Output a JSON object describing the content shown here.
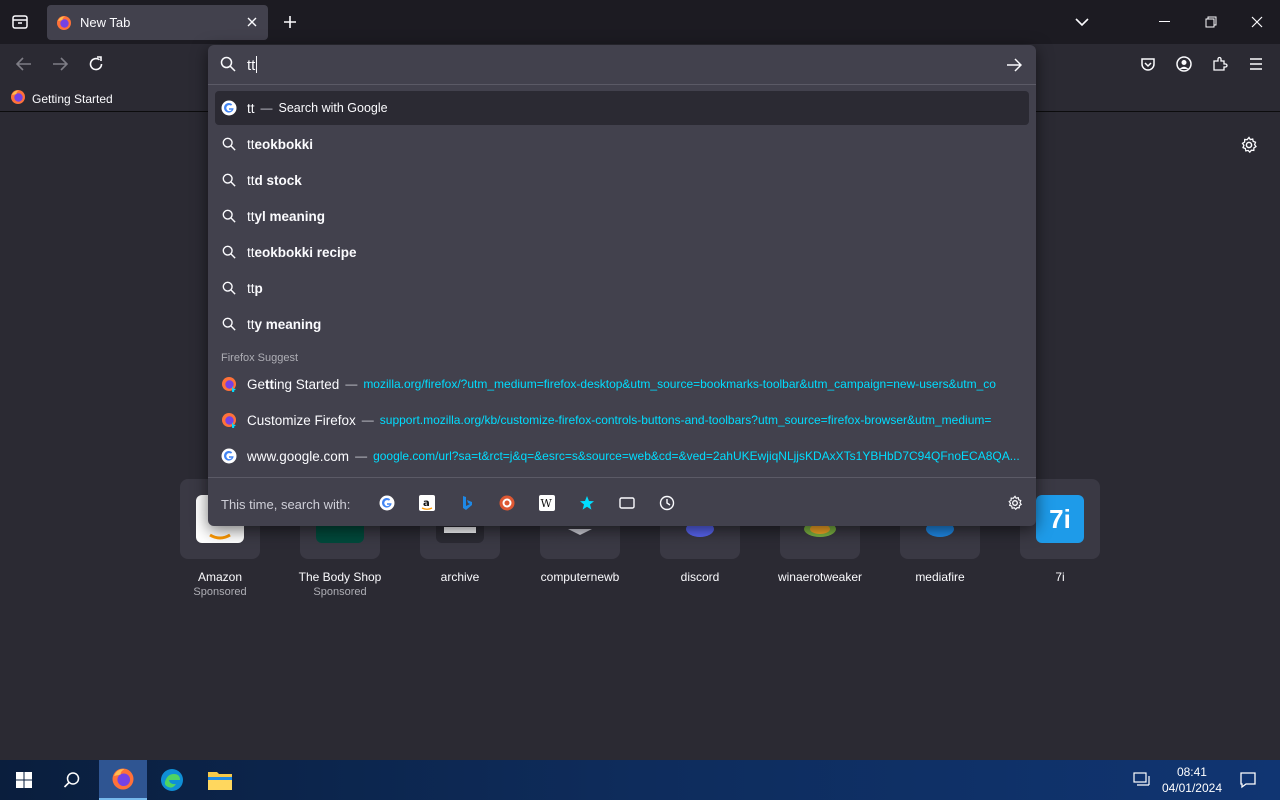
{
  "browser": {
    "tab_title": "New Tab",
    "bookmark_label": "Getting Started"
  },
  "urlbar": {
    "typed": "tt"
  },
  "results": {
    "heuristic": {
      "typed": "tt",
      "sep": "—",
      "action": "Search with Google"
    },
    "suggestions": [
      {
        "typed": "tt",
        "completion": "eokbokki"
      },
      {
        "typed": "tt",
        "completion": "d stock"
      },
      {
        "typed": "tt",
        "completion": "yl meaning"
      },
      {
        "typed": "tt",
        "completion": "eokbokki recipe"
      },
      {
        "typed": "tt",
        "completion": "p"
      },
      {
        "typed": "tt",
        "completion": "y meaning"
      }
    ],
    "group_label": "Firefox Suggest",
    "bookmarks": [
      {
        "title_pre": "Ge",
        "title_hl": "tt",
        "title_post": "ing Started",
        "sep": "—",
        "url": "mozilla.org/firefox/?utm_medium=firefox-desktop&utm_source=bookmarks-toolbar&utm_campaign=new-users&utm_co"
      },
      {
        "title_pre": "Customize Firefox",
        "title_hl": "",
        "title_post": "",
        "sep": "—",
        "url": "support.mozilla.org/kb/customize-firefox-controls-buttons-and-toolbars?utm_source=firefox-browser&utm_medium="
      },
      {
        "title_pre": "www.google.com",
        "title_hl": "",
        "title_post": "",
        "sep": "—",
        "url": "google.com/url?sa=t&rct=j&q=&esrc=s&source=web&cd=&ved=2ahUKEwjiqNLjjsKDAxXTs1YBHbD7C94QFnoECA8QA..."
      }
    ]
  },
  "oneoff": {
    "label": "This time, search with:"
  },
  "tiles": [
    {
      "label": "Amazon",
      "sub": "Sponsored"
    },
    {
      "label": "The Body Shop",
      "sub": "Sponsored"
    },
    {
      "label": "archive",
      "sub": ""
    },
    {
      "label": "computernewb",
      "sub": ""
    },
    {
      "label": "discord",
      "sub": ""
    },
    {
      "label": "winaerotweaker",
      "sub": ""
    },
    {
      "label": "mediafire",
      "sub": ""
    },
    {
      "label": "7i",
      "sub": ""
    }
  ],
  "tile_7i_text": "7i",
  "taskbar": {
    "time": "08:41",
    "date": "04/01/2024"
  },
  "colors": {
    "url_link": "#00ddff",
    "accent": "#00ddff",
    "popup_bg": "#42414d",
    "page_bg": "#2b2a33"
  }
}
